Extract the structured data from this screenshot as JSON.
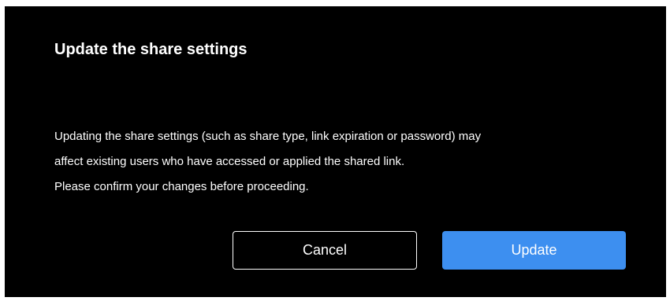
{
  "dialog": {
    "title": "Update the share settings",
    "message_lines": [
      "Updating the share settings (such as share type, link expiration or password) may",
      "affect existing users who have accessed or applied the shared link.",
      "Please confirm your changes before proceeding."
    ],
    "cancel_label": "Cancel",
    "update_label": "Update"
  },
  "colors": {
    "dialog_background": "#000000",
    "text": "#ffffff",
    "primary_button": "#3d8ff0"
  }
}
